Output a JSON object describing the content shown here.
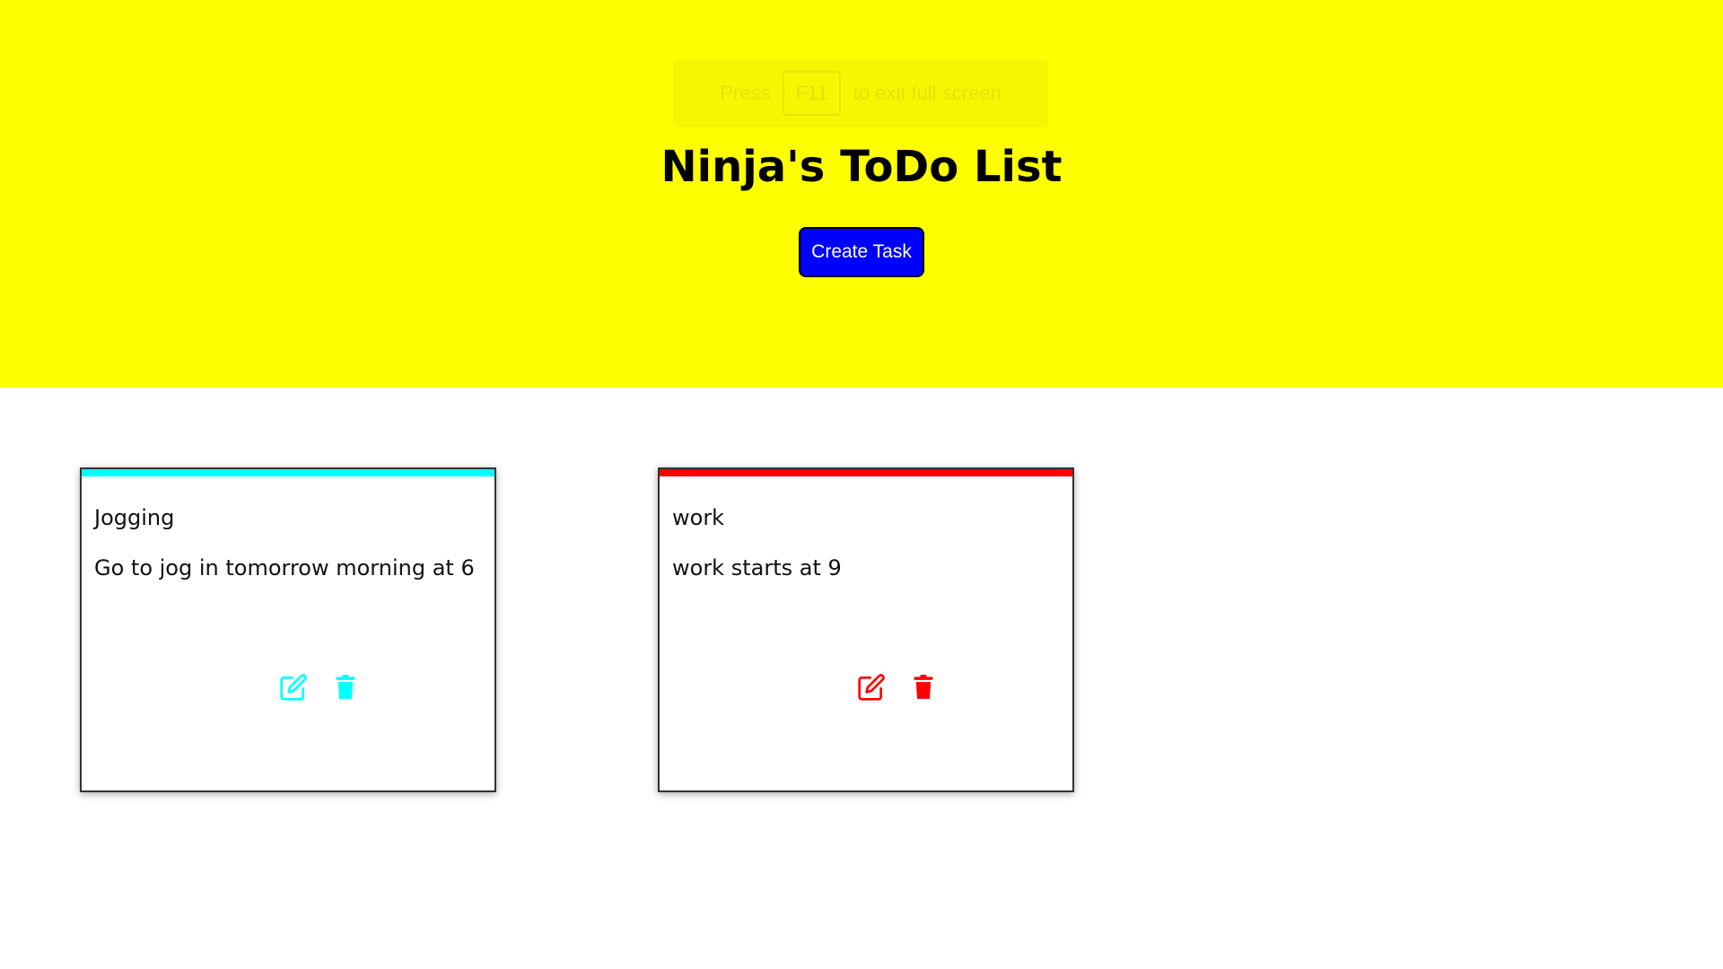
{
  "header": {
    "background_color": "#ffff00",
    "fullscreen_notice": {
      "prefix": "Press",
      "key": "F11",
      "suffix": "to exit full screen"
    },
    "title": "Ninja's ToDo List",
    "create_button_label": "Create Task",
    "create_button_color": "#0000ff"
  },
  "tasks": [
    {
      "title": "Jogging",
      "description": "Go to jog in tomorrow morning at 6",
      "color": "#00ffff",
      "edit_icon": "edit-icon",
      "delete_icon": "trash-icon"
    },
    {
      "title": "work",
      "description": "work starts at 9",
      "color": "#ff0000",
      "edit_icon": "edit-icon",
      "delete_icon": "trash-icon"
    }
  ]
}
